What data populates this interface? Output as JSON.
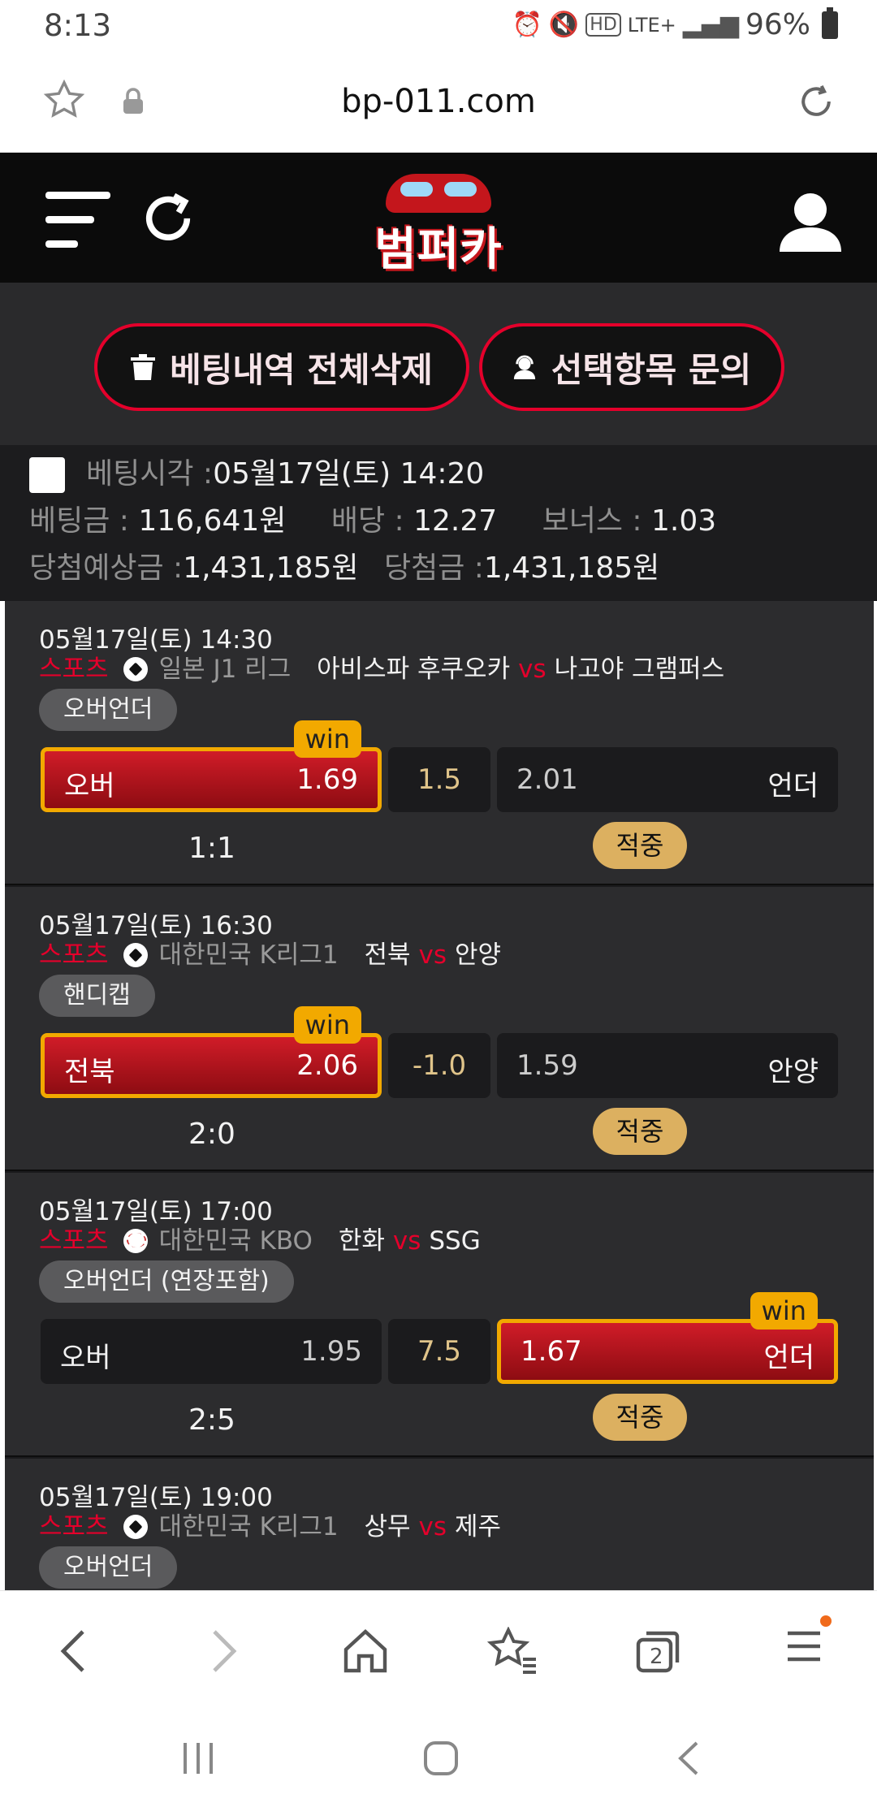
{
  "status": {
    "time": "8:13",
    "network": "LTE+",
    "battery": "96%"
  },
  "browser": {
    "url": "bp-011.com",
    "tab_count": "2"
  },
  "site": {
    "logo_text": "범퍼카"
  },
  "actions": {
    "delete_all": "베팅내역 전체삭제",
    "inquiry": "선택항목 문의"
  },
  "summary": {
    "bet_time_label": "베팅시각 :",
    "bet_time": "05월17일(토) 14:20",
    "stake_label": "베팅금 :",
    "stake": "116,641원",
    "odds_label": "배당 :",
    "odds": "12.27",
    "bonus_label": "보너스 :",
    "bonus": "1.03",
    "expected_label": "당첨예상금 :",
    "expected": "1,431,185원",
    "won_label": "당첨금 :",
    "won": "1,431,185원"
  },
  "bets": [
    {
      "datetime": "05월17일(토) 14:30",
      "category": "스포츠",
      "sport_icon": "soccer-ball-icon",
      "league": "일본 J1 리그",
      "home": "아비스파 후쿠오카",
      "vs": "vs",
      "away": "나고야 그램퍼스",
      "market": "오버언더",
      "home_label": "오버",
      "home_odds": "1.69",
      "line": "1.5",
      "away_odds": "2.01",
      "away_label": "언더",
      "selected": "home",
      "win_badge": "win",
      "score": "1:1",
      "result": "적중"
    },
    {
      "datetime": "05월17일(토) 16:30",
      "category": "스포츠",
      "sport_icon": "soccer-ball-icon",
      "league": "대한민국 K리그1",
      "home": "전북",
      "vs": "vs",
      "away": "안양",
      "market": "핸디캡",
      "home_label": "전북",
      "home_odds": "2.06",
      "line": "-1.0",
      "away_odds": "1.59",
      "away_label": "안양",
      "selected": "home",
      "win_badge": "win",
      "score": "2:0",
      "result": "적중"
    },
    {
      "datetime": "05월17일(토) 17:00",
      "category": "스포츠",
      "sport_icon": "baseball-icon",
      "league": "대한민국 KBO",
      "home": "한화",
      "vs": "vs",
      "away": "SSG",
      "market": "오버언더 (연장포함)",
      "home_label": "오버",
      "home_odds": "1.95",
      "line": "7.5",
      "away_odds": "1.67",
      "away_label": "언더",
      "selected": "away",
      "win_badge": "win",
      "score": "2:5",
      "result": "적중"
    },
    {
      "datetime": "05월17일(토) 19:00",
      "category": "스포츠",
      "sport_icon": "soccer-ball-icon",
      "league": "대한민국 K리그1",
      "home": "상무",
      "vs": "vs",
      "away": "제주",
      "market": "오버언더"
    }
  ],
  "colors": {
    "accent_red": "#e4002b",
    "win_gold": "#f2a900",
    "result_gold": "#dcb060",
    "dark_bg": "#2c2c2e"
  }
}
